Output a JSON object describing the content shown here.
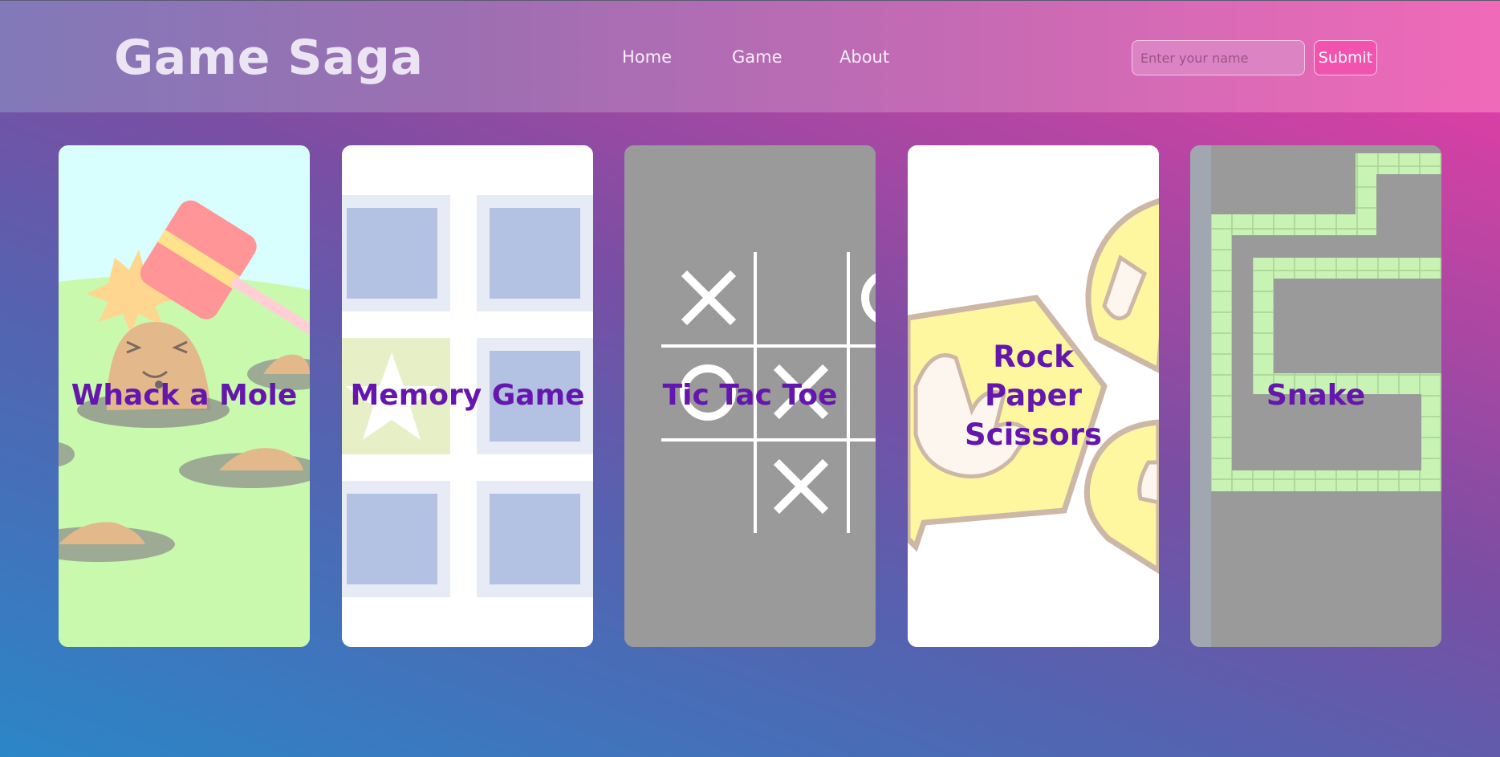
{
  "header": {
    "logo": "Game Saga",
    "nav": [
      "Home",
      "Game",
      "About"
    ],
    "name_placeholder": "Enter your name",
    "submit_label": "Submit"
  },
  "cards": [
    {
      "title": "Whack a Mole",
      "art": "whack-a-mole-illustration"
    },
    {
      "title": "Memory Game",
      "art": "memory-grid-illustration"
    },
    {
      "title": "Tic Tac Toe",
      "art": "tic-tac-toe-board-illustration"
    },
    {
      "title": "Rock Paper Scissors",
      "art": "hand-gestures-illustration"
    },
    {
      "title": "Snake",
      "art": "snake-grid-illustration"
    }
  ],
  "colors": {
    "title_purple": "#6416ad",
    "submit_pink": "#f153ae",
    "header_start": "#8279b8",
    "header_end": "#f06ab8"
  }
}
